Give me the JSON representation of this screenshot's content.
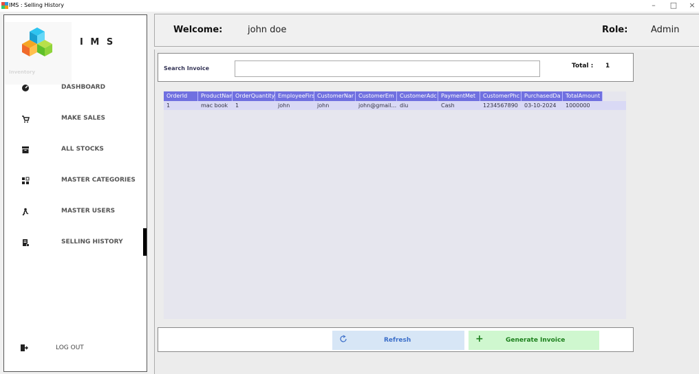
{
  "window": {
    "title": "IMS : Selling History",
    "controls": [
      "–",
      "□",
      "×"
    ]
  },
  "sidebar": {
    "app_name": "I M S",
    "logo_caption": "Inventory",
    "items": [
      {
        "label": "DASHBOARD",
        "icon": "dashboard-icon"
      },
      {
        "label": "MAKE SALES",
        "icon": "cart-icon"
      },
      {
        "label": "ALL STOCKS",
        "icon": "stock-icon"
      },
      {
        "label": "MASTER CATEGORIES",
        "icon": "categories-icon"
      },
      {
        "label": "MASTER USERS",
        "icon": "users-icon"
      },
      {
        "label": "SELLING HISTORY",
        "icon": "receipt-icon"
      }
    ],
    "logout_label": "LOG OUT",
    "active_index": 5
  },
  "header": {
    "welcome_label": "Welcome:",
    "username": "john doe",
    "role_label": "Role:",
    "role_value": "Admin"
  },
  "search": {
    "label": "Search Invoice",
    "value": "",
    "total_label": "Total :",
    "total_value": "1"
  },
  "table": {
    "columns": [
      "OrderId",
      "ProductName",
      "OrderQuantity",
      "EmployeeFirs",
      "CustomerNar",
      "CustomerEm",
      "CustomerAdc",
      "PaymentMet",
      "CustomerPhc",
      "PurchasedDa",
      "TotalAmount"
    ],
    "rows": [
      [
        "1",
        "mac book",
        "1",
        "john",
        "john",
        "john@gmail...",
        "diu",
        "Cash",
        "1234567890",
        "03-10-2024",
        "1000000"
      ]
    ]
  },
  "actions": {
    "refresh_label": "Refresh",
    "generate_label": "Generate Invoice"
  },
  "colors": {
    "grid_header": "#7070e0",
    "row_selected": "#d9d9f5",
    "refresh_bg": "#d7e6f6",
    "generate_bg": "#cff7cf"
  }
}
